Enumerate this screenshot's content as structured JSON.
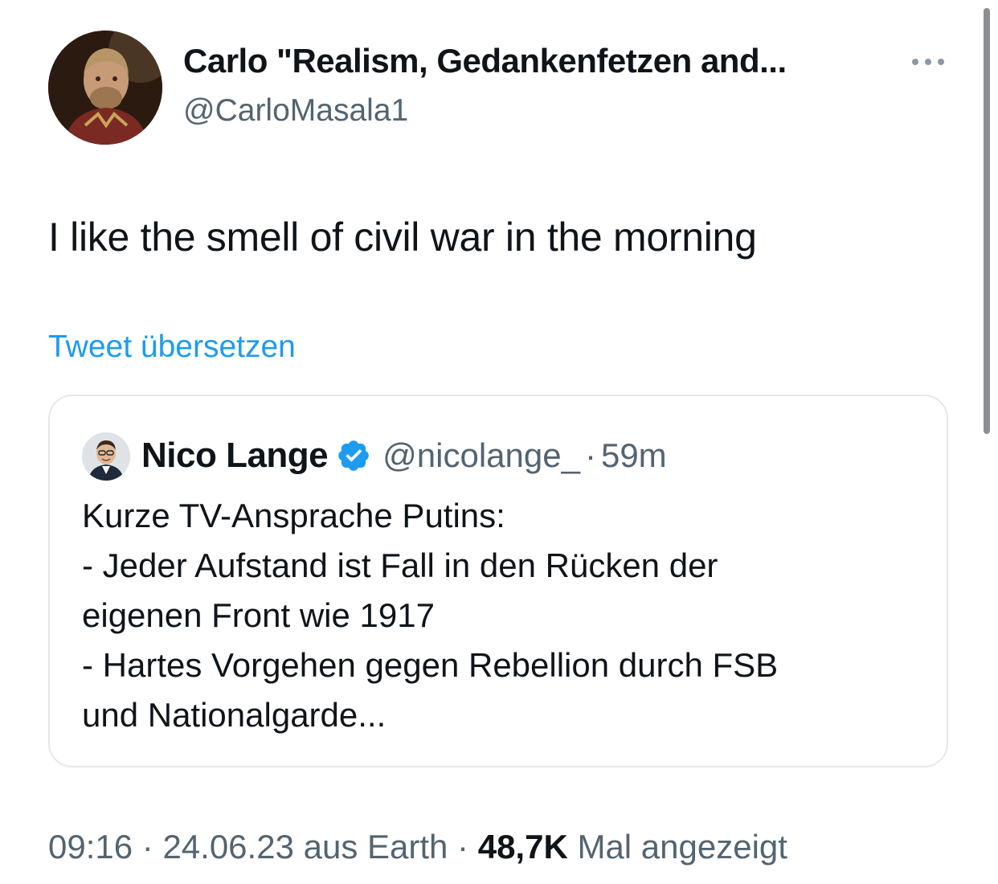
{
  "tweet": {
    "author": {
      "display_name": "Carlo \"Realism, Gedankenfetzen and...",
      "handle": "@CarloMasala1"
    },
    "more_icon": "more-horizontal-icon",
    "text": "I like the smell of civil war in the morning",
    "translate_label": "Tweet übersetzen",
    "meta": {
      "time": "09:16",
      "sep1": " · ",
      "date": "24.06.23",
      "source": " aus Earth",
      "sep2": " · ",
      "views_count": "48,7K",
      "views_label": " Mal angezeigt"
    }
  },
  "quoted_tweet": {
    "author": {
      "display_name": "Nico Lange",
      "verified_icon": "verified-badge-icon",
      "handle": "@nicolange_",
      "dot": "·",
      "time": "59m"
    },
    "lines": [
      "Kurze TV-Ansprache Putins:",
      "- Jeder Aufstand ist Fall in den Rücken der",
      "eigenen Front wie 1917",
      "- Hartes Vorgehen gegen Rebellion durch FSB",
      "und Nationalgarde..."
    ]
  },
  "colors": {
    "link": "#1d9bf0",
    "secondary_text": "#536471",
    "primary_text": "#0f1419",
    "border": "#e4e8eb",
    "verified": "#1d9bf0"
  }
}
